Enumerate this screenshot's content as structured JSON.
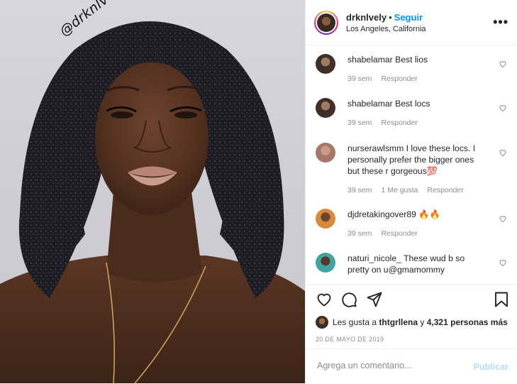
{
  "post": {
    "username": "drknlvely",
    "follow_label": "Seguir",
    "separator": "•",
    "location": "Los Angeles, California",
    "more_icon": "more-horizontal-icon",
    "watermark": "@drknlvely"
  },
  "comments": [
    {
      "user": "shabelamar",
      "text": "Best lios",
      "time": "39 sem",
      "likes": "",
      "reply": "Responder"
    },
    {
      "user": "shabelamar",
      "text": "Best locs",
      "time": "39 sem",
      "likes": "",
      "reply": "Responder"
    },
    {
      "user": "nurserawlsmm",
      "text": "I love these locs. I personally prefer the bigger ones but these r gorgeous💯",
      "time": "39 sem",
      "likes": "1 Me gusta",
      "reply": "Responder"
    },
    {
      "user": "djdretakingover89",
      "text": "🔥🔥",
      "time": "39 sem",
      "likes": "",
      "reply": "Responder"
    },
    {
      "user": "naturi_nicole_",
      "text": "These wud b so pretty on u@gmamommy",
      "time": "",
      "likes": "",
      "reply": ""
    }
  ],
  "likes": {
    "prefix": "Les gusta a",
    "liker": "thtgrllena",
    "connector": "y",
    "others": "4,321 personas más"
  },
  "date": "20 DE MAYO DE 2019",
  "add_comment": {
    "placeholder": "Agrega un comentario...",
    "publish_label": "Publicar"
  },
  "icons": [
    "heart-icon",
    "comment-icon",
    "share-icon",
    "bookmark-icon"
  ],
  "colors": {
    "link_blue": "#0095f6",
    "publish_disabled": "#b2dffc",
    "meta_gray": "#8e8e8e",
    "text": "#262626"
  }
}
